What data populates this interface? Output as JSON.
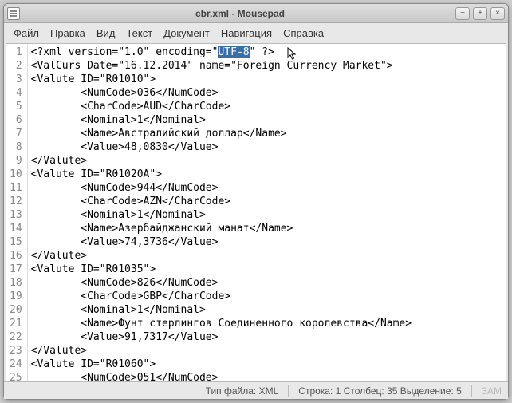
{
  "window": {
    "title": "cbr.xml - Mousepad"
  },
  "menu": {
    "file": "Файл",
    "edit": "Правка",
    "view": "Вид",
    "text": "Текст",
    "document": "Документ",
    "navigation": "Навигация",
    "help": "Справка"
  },
  "code": {
    "lines": [
      "1",
      "2",
      "3",
      "4",
      "5",
      "6",
      "7",
      "8",
      "9",
      "10",
      "11",
      "12",
      "13",
      "14",
      "15",
      "16",
      "17",
      "18",
      "19",
      "20",
      "21",
      "22",
      "23",
      "24",
      "25"
    ],
    "l1a": "<?xml version=\"1.0\" encoding=\"",
    "l1sel": "UTF-8",
    "l1b": "\" ?>",
    "l2": "<ValCurs Date=\"16.12.2014\" name=\"Foreign Currency Market\">",
    "l3": "<Valute ID=\"R01010\">",
    "l4": "        <NumCode>036</NumCode>",
    "l5": "        <CharCode>AUD</CharCode>",
    "l6": "        <Nominal>1</Nominal>",
    "l7": "        <Name>Австралийский доллар</Name>",
    "l8": "        <Value>48,0830</Value>",
    "l9": "</Valute>",
    "l10": "<Valute ID=\"R01020A\">",
    "l11": "        <NumCode>944</NumCode>",
    "l12": "        <CharCode>AZN</CharCode>",
    "l13": "        <Nominal>1</Nominal>",
    "l14": "        <Name>Азербайджанский манат</Name>",
    "l15": "        <Value>74,3736</Value>",
    "l16": "</Valute>",
    "l17": "<Valute ID=\"R01035\">",
    "l18": "        <NumCode>826</NumCode>",
    "l19": "        <CharCode>GBP</CharCode>",
    "l20": "        <Nominal>1</Nominal>",
    "l21": "        <Name>Фунт стерлингов Соединенного королевства</Name>",
    "l22": "        <Value>91,7317</Value>",
    "l23": "</Valute>",
    "l24": "<Valute ID=\"R01060\">",
    "l25": "        <NumCode>051</NumCode>"
  },
  "status": {
    "filetype_label": "Тип файла:",
    "filetype_value": "XML",
    "pos_label_line": "Строка:",
    "pos_line": "1",
    "pos_label_col": "Столбец:",
    "pos_col": "35",
    "sel_label": "Выделение:",
    "sel_count": "5",
    "caps": "ЗАМ"
  }
}
